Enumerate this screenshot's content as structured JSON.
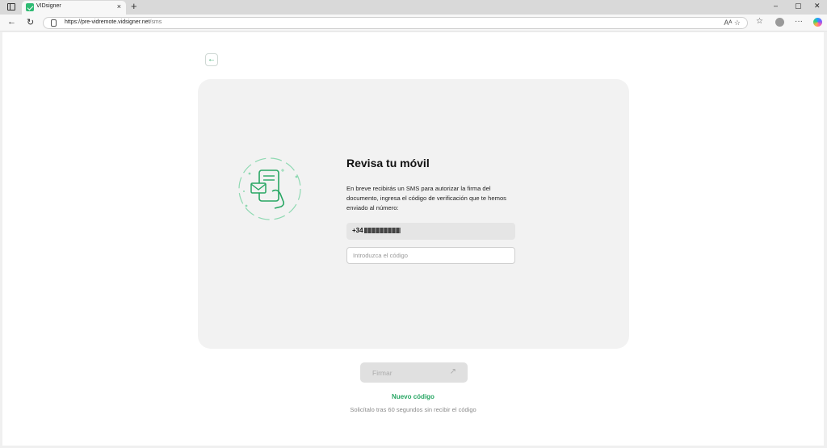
{
  "browser": {
    "tab_title": "VIDsigner",
    "tab_close": "×",
    "new_tab": "+",
    "url_host": "https://pre-vidremote.vidsigner.net",
    "url_path": "/sms",
    "url_icons": "Aᴬ ☆",
    "window_controls": [
      "–",
      "▢",
      "✕"
    ],
    "more": "···"
  },
  "page": {
    "back_icon": "arrow-left-icon",
    "title": "Revisa tu móvil",
    "description": "En breve recibirás un SMS para autorizar la firma del documento, ingresa el código de verificación que te hemos enviado al número:",
    "phone_prefix": "+34",
    "code_placeholder": "Introduzca el código",
    "sign_label": "Firmar",
    "new_code_label": "Nuevo código",
    "hint": "Solicítalo tras 60 segundos sin recibir el código"
  },
  "colors": {
    "accent": "#27a663",
    "card_bg": "#f2f2f2",
    "disabled_button": "#e0e0e0"
  }
}
